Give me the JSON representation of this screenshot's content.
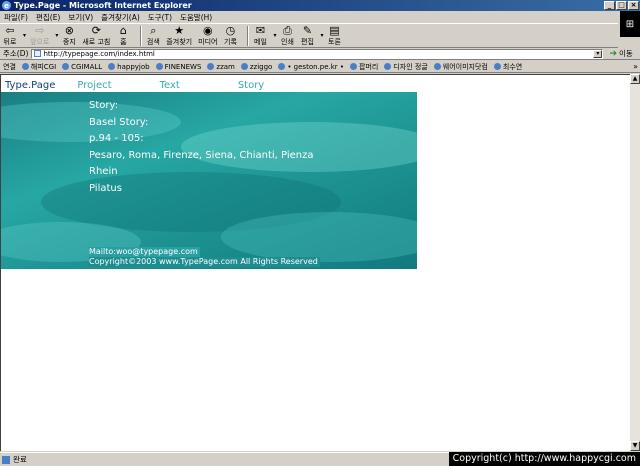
{
  "window": {
    "title": "Type.Page - Microsoft Internet Explorer",
    "controls": [
      "_",
      "□",
      "×"
    ]
  },
  "menu": [
    "파일(F)",
    "편집(E)",
    "보기(V)",
    "즐겨찾기(A)",
    "도구(T)",
    "도움말(H)"
  ],
  "toolbar": {
    "back": "뒤로",
    "forward": "앞으로",
    "stop": "중지",
    "refresh": "새로 고침",
    "home": "홈",
    "search": "검색",
    "favorites": "즐겨찾기",
    "media": "미디어",
    "history": "기록",
    "mail": "메일",
    "print": "인쇄",
    "edit": "편집",
    "discuss": "토론"
  },
  "address": {
    "label": "주소(D)",
    "url": "http://typepage.com/index.html",
    "go": "이동"
  },
  "links": {
    "label": "연결",
    "items": [
      "해피CGI",
      "CGIMALL",
      "happyjob",
      "FINENEWS",
      "zzam",
      "zziggo",
      "• geston.pe.kr •",
      "팝머리",
      "디자인 정글",
      "웨어이미지닷컴",
      "최수연"
    ],
    "more": "»"
  },
  "site": {
    "brand": "Type.Page",
    "nav": [
      "Project",
      "Text",
      "Story"
    ],
    "content_lines": [
      "Story:",
      "Basel Story:",
      "p.94 - 105:",
      "Pesaro, Roma, Firenze, Siena, Chianti, Pienza",
      "Rhein",
      "Pilatus"
    ],
    "mailto": "Mailto:woo@typepage.com",
    "copyright": "Copyright©2003 www.TypePage.com All Rights Reserved"
  },
  "status": {
    "text": "완료"
  },
  "watermark": "Copyright(c) http://www.happycgi.com",
  "colors": {
    "titlebar_start": "#0a246a",
    "brand": "#0f3f7a",
    "nav": "#3aa8b0",
    "hero": "#27a7a4"
  }
}
